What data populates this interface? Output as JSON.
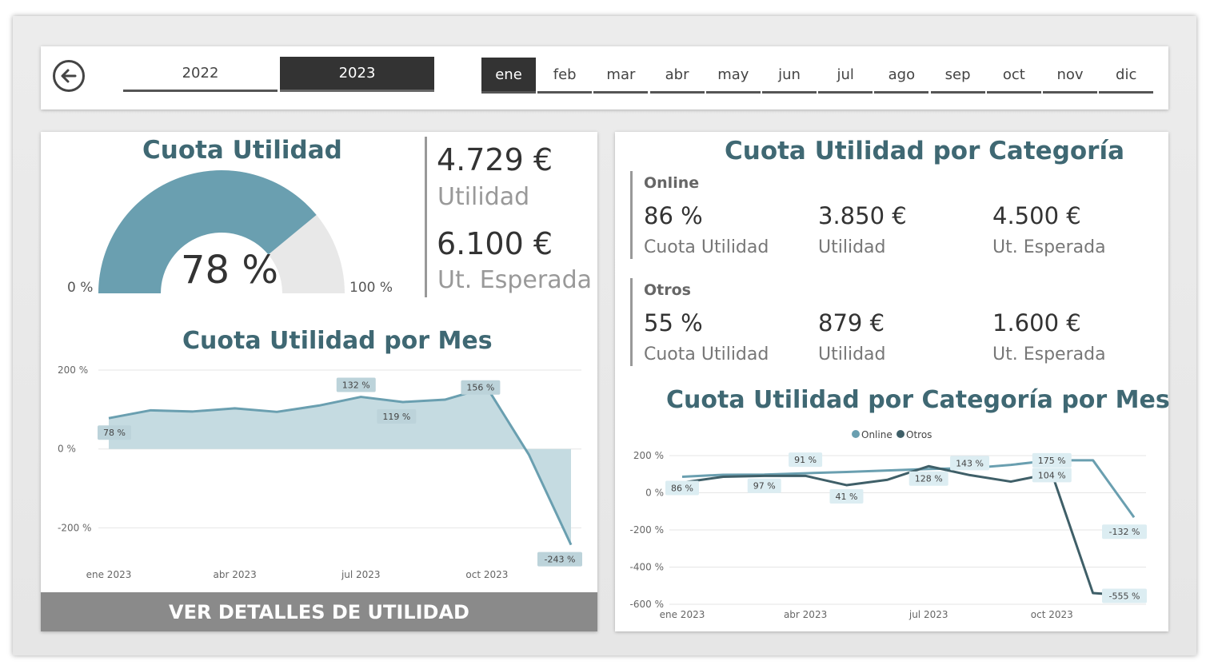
{
  "nav": {
    "years": [
      "2022",
      "2023"
    ],
    "selected_year": "2023",
    "months": [
      "ene",
      "feb",
      "mar",
      "abr",
      "may",
      "jun",
      "jul",
      "ago",
      "sep",
      "oct",
      "nov",
      "dic"
    ],
    "selected_month": "ene"
  },
  "left": {
    "gauge_title": "Cuota Utilidad",
    "gauge_value": "78 %",
    "gauge_fraction": 0.78,
    "gauge_min": "0 %",
    "gauge_max": "100 %",
    "utilidad_value": "4.729 €",
    "utilidad_label": "Utilidad",
    "esperada_value": "6.100 €",
    "esperada_label": "Ut. Esperada",
    "month_chart_title": "Cuota Utilidad por Mes",
    "details_button": "VER DETALLES DE UTILIDAD"
  },
  "right": {
    "title": "Cuota Utilidad por Categoría",
    "categories": [
      {
        "name": "Online",
        "cuota": "86 %",
        "cuota_label": "Cuota Utilidad",
        "utilidad": "3.850 €",
        "utilidad_label": "Utilidad",
        "esperada": "4.500 €",
        "esperada_label": "Ut. Esperada"
      },
      {
        "name": "Otros",
        "cuota": "55 %",
        "cuota_label": "Cuota Utilidad",
        "utilidad": "879 €",
        "utilidad_label": "Utilidad",
        "esperada": "1.600 €",
        "esperada_label": "Ut. Esperada"
      }
    ],
    "cat_chart_title": "Cuota Utilidad por Categoría por Mes"
  },
  "colors": {
    "accent": "#6a9fb0",
    "dark_series": "#3f5f68",
    "title": "#3f6873"
  },
  "chart_data": [
    {
      "type": "area",
      "title": "Cuota Utilidad por Mes",
      "x": [
        "ene 2023",
        "feb 2023",
        "mar 2023",
        "abr 2023",
        "may 2023",
        "jun 2023",
        "jul 2023",
        "ago 2023",
        "sep 2023",
        "oct 2023",
        "nov 2023",
        "dic 2023"
      ],
      "x_tick_labels": [
        "ene 2023",
        "abr 2023",
        "jul 2023",
        "oct 2023"
      ],
      "values": [
        78,
        98,
        95,
        103,
        94,
        110,
        132,
        119,
        125,
        156,
        -15,
        -243
      ],
      "data_labels": [
        {
          "index": 0,
          "text": "78 %"
        },
        {
          "index": 6,
          "text": "132 %"
        },
        {
          "index": 7,
          "text": "119 %"
        },
        {
          "index": 9,
          "text": "156 %"
        },
        {
          "index": 11,
          "text": "-243 %"
        }
      ],
      "y_ticks": [
        "200 %",
        "0 %",
        "-200 %"
      ],
      "ylim": [
        -260,
        200
      ],
      "grid": true
    },
    {
      "type": "line",
      "title": "Cuota Utilidad por Categoría por Mes",
      "x": [
        "ene 2023",
        "feb 2023",
        "mar 2023",
        "abr 2023",
        "may 2023",
        "jun 2023",
        "jul 2023",
        "ago 2023",
        "sep 2023",
        "oct 2023",
        "nov 2023",
        "dic 2023"
      ],
      "x_tick_labels": [
        "ene 2023",
        "abr 2023",
        "jul 2023",
        "oct 2023"
      ],
      "legend": [
        "Online",
        "Otros"
      ],
      "legend_position": "top",
      "series": [
        {
          "name": "Online",
          "values": [
            86,
            97,
            98,
            105,
            112,
            120,
            128,
            132,
            150,
            175,
            175,
            -132
          ]
        },
        {
          "name": "Otros",
          "values": [
            55,
            86,
            91,
            91,
            41,
            70,
            143,
            95,
            60,
            104,
            -540,
            -555
          ]
        }
      ],
      "data_labels": [
        {
          "text": "86 %",
          "index": 0
        },
        {
          "text": "97 %",
          "index": 2
        },
        {
          "text": "91 %",
          "index": 3
        },
        {
          "text": "41 %",
          "index": 4
        },
        {
          "text": "128 %",
          "index": 6
        },
        {
          "text": "143 %",
          "index": 7
        },
        {
          "text": "175 %",
          "index": 9
        },
        {
          "text": "104 %",
          "index": 9
        },
        {
          "text": "-132 %",
          "index": 11
        },
        {
          "text": "-555 %",
          "index": 11
        }
      ],
      "y_ticks": [
        "200 %",
        "0 %",
        "-200 %",
        "-400 %",
        "-600 %"
      ],
      "ylim": [
        -600,
        200
      ],
      "grid": true
    }
  ]
}
